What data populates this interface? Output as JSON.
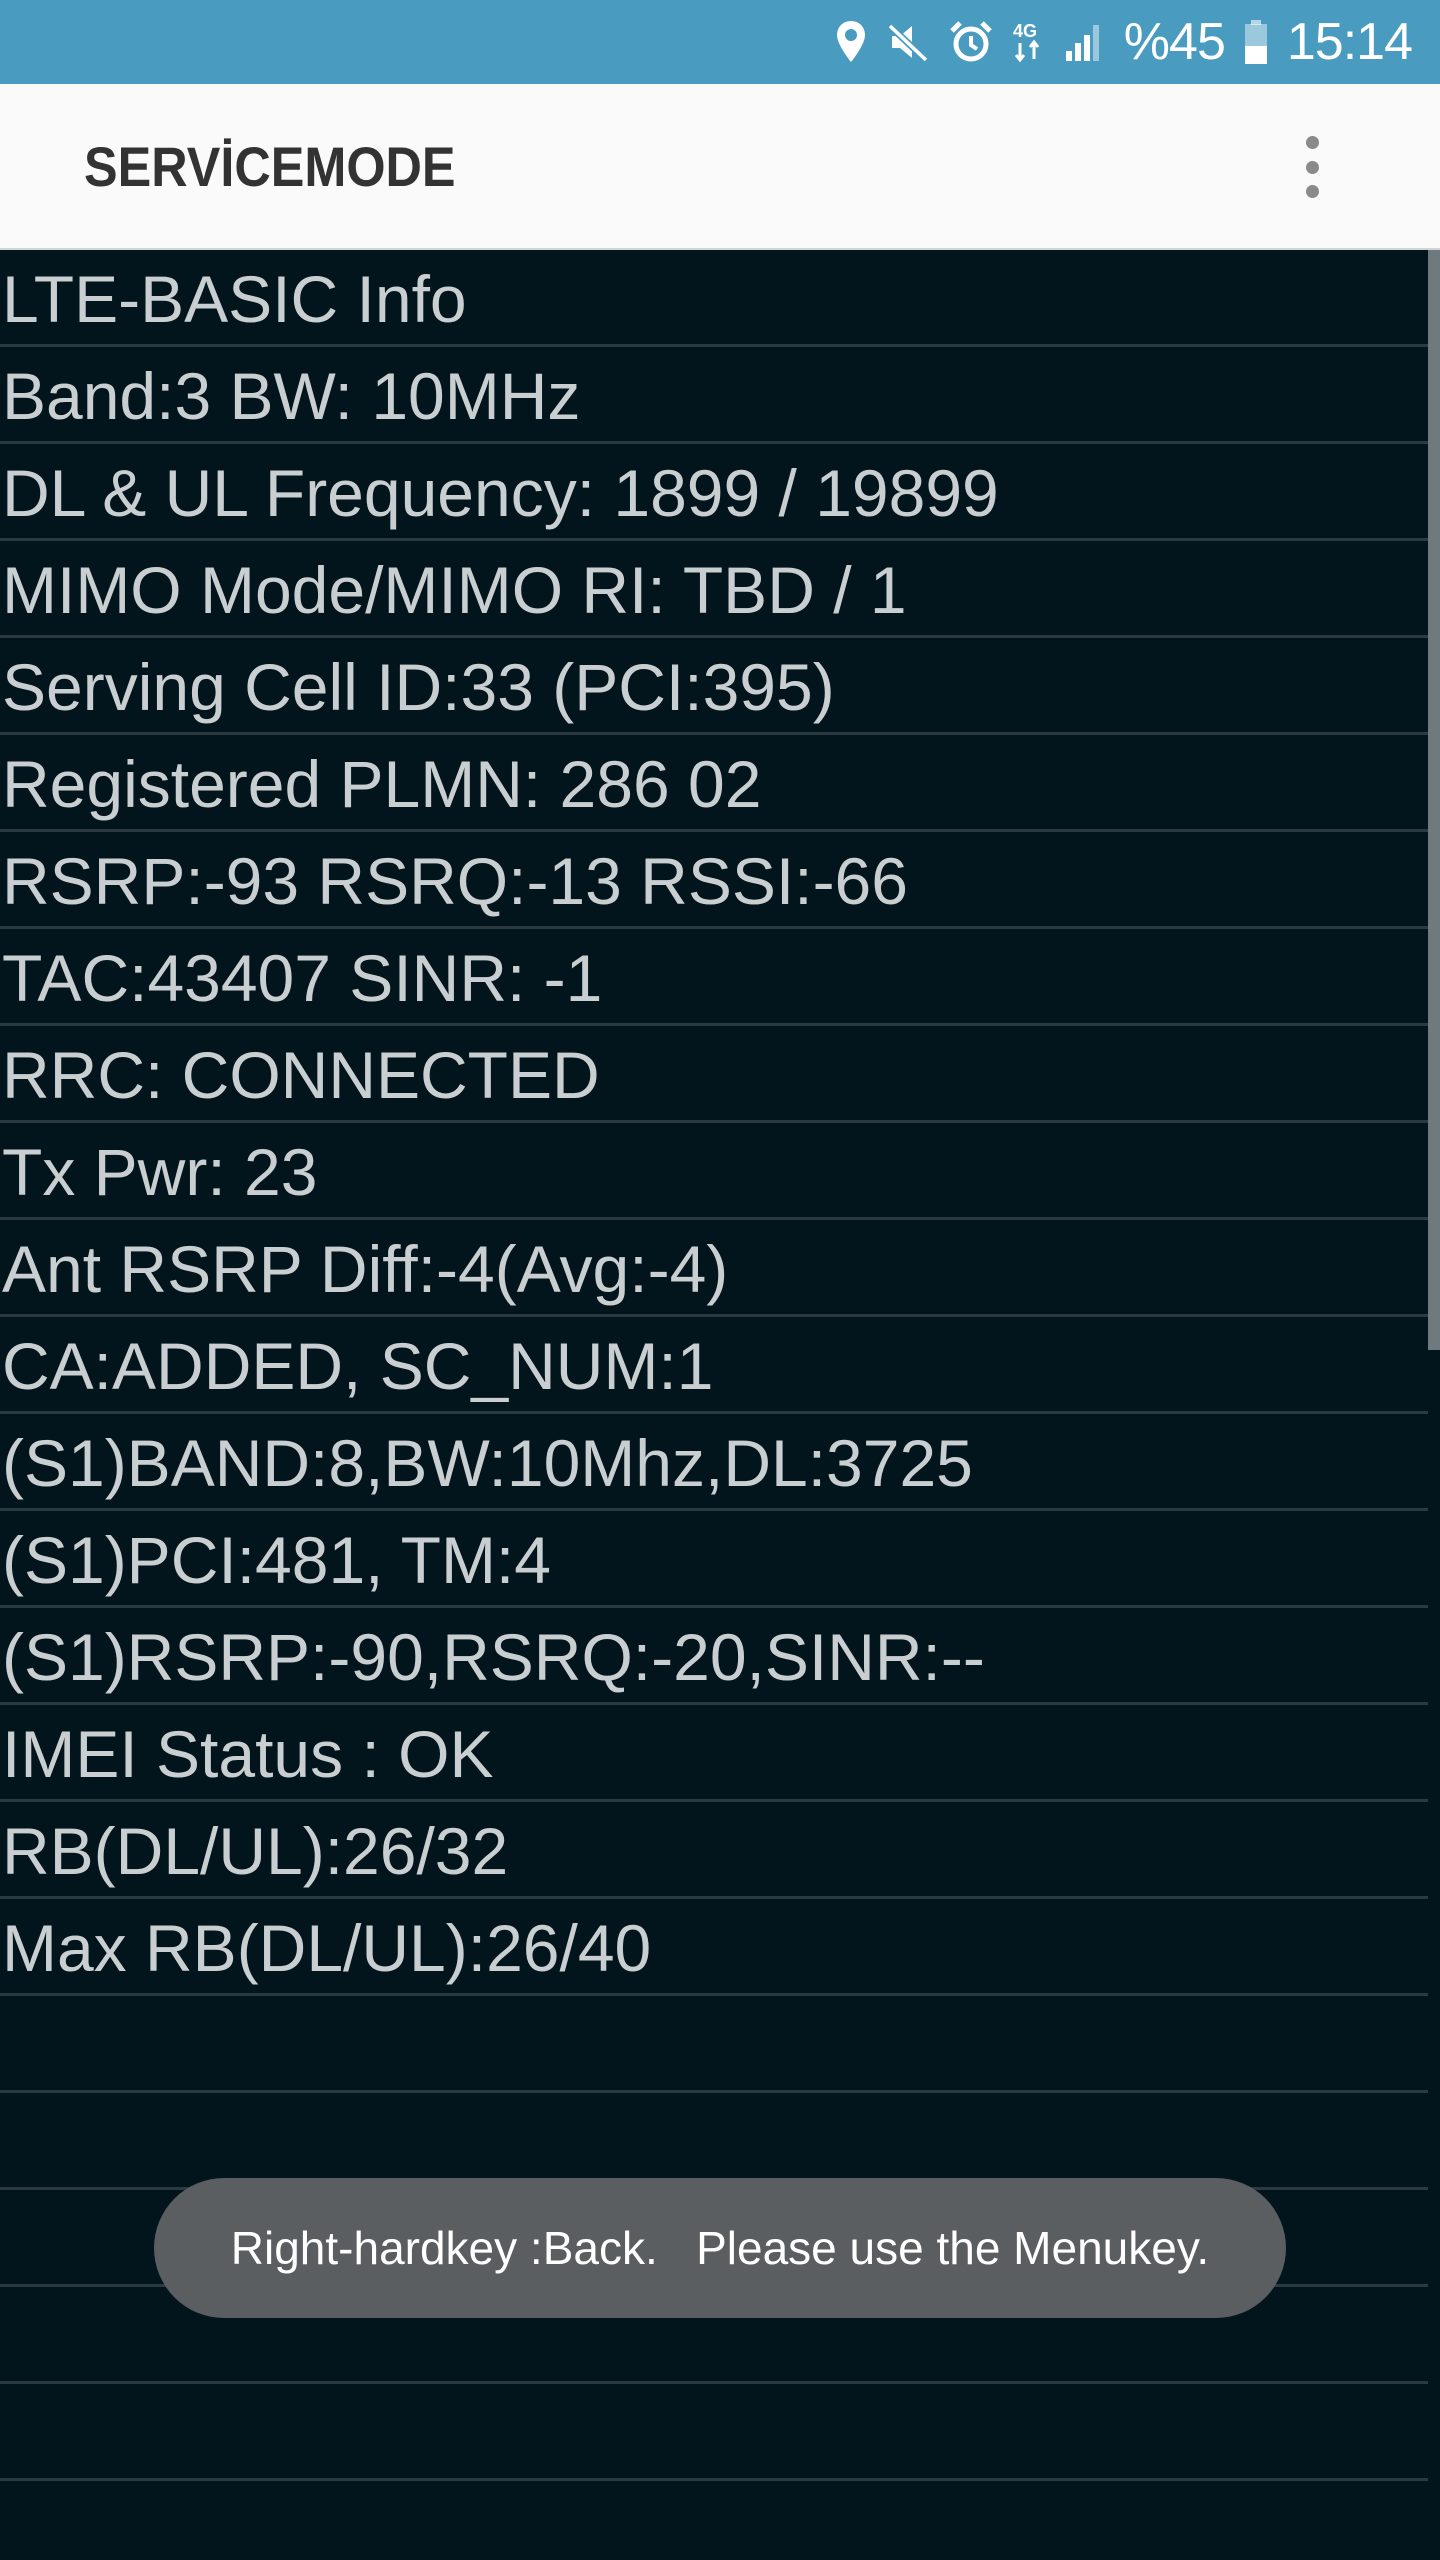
{
  "status_bar": {
    "icons": [
      "location-icon",
      "mute-icon",
      "alarm-icon",
      "4g-data-icon",
      "signal-icon",
      "battery-icon"
    ],
    "network_label": "4G",
    "battery": "%45",
    "battery_level": 0.45,
    "time": "15:14"
  },
  "app_bar": {
    "title": "SERVİCEMODE",
    "menu_icon": "more-vert-icon"
  },
  "info_lines": [
    "LTE-BASIC Info",
    "Band:3 BW: 10MHz",
    "DL & UL Frequency: 1899 / 19899",
    "MIMO Mode/MIMO RI: TBD / 1",
    "Serving Cell ID:33 (PCI:395)",
    "Registered PLMN: 286 02",
    "RSRP:-93 RSRQ:-13 RSSI:-66",
    "TAC:43407 SINR: -1",
    "RRC: CONNECTED",
    "Tx Pwr: 23",
    "Ant RSRP Diff:-4(Avg:-4)",
    "CA:ADDED, SC_NUM:1",
    "(S1)BAND:8,BW:10Mhz,DL:3725",
    "(S1)PCI:481, TM:4",
    "(S1)RSRP:-90,RSRQ:-20,SINR:--",
    "IMEI Status : OK",
    "RB(DL/UL):26/32",
    "Max RB(DL/UL):26/40",
    "",
    "",
    "",
    "",
    "",
    ""
  ],
  "toast": {
    "message": "Right-hardkey :Back.   Please use the Menukey."
  },
  "colors": {
    "status_bar": "#4a9bc0",
    "app_bar": "#fafafa",
    "content_bg": "#03151c",
    "text": "#c9cfd1",
    "divider": "#2b3a40",
    "toast_bg": "#5b5e60"
  }
}
